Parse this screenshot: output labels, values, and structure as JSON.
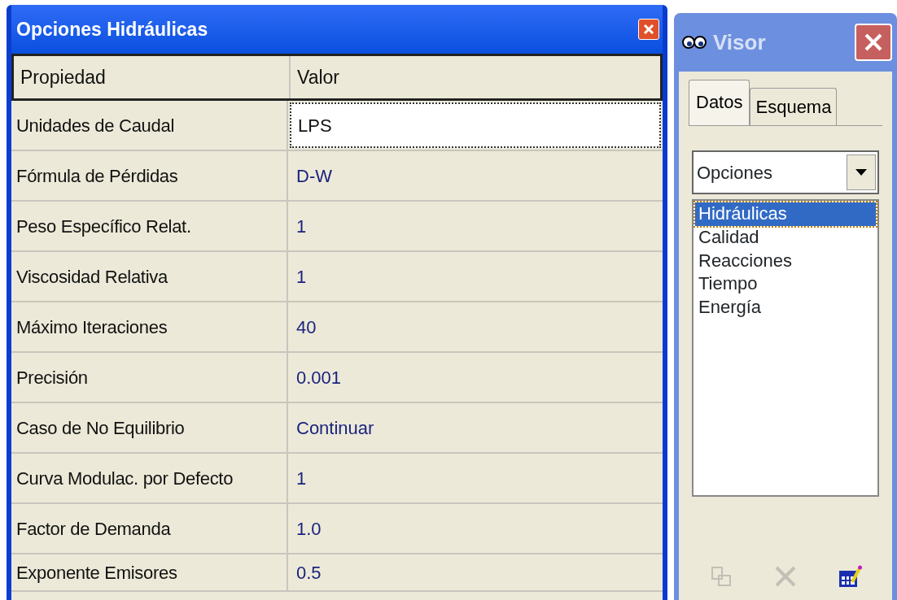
{
  "left_window": {
    "title": "Opciones Hidráulicas",
    "table": {
      "columns": [
        "Propiedad",
        "Valor"
      ],
      "rows": [
        {
          "property": "Unidades de Caudal",
          "value": "LPS",
          "selected": true
        },
        {
          "property": "Fórmula de Pérdidas",
          "value": "D-W",
          "selected": false
        },
        {
          "property": "Peso Específico Relat.",
          "value": "1",
          "selected": false
        },
        {
          "property": "Viscosidad Relativa",
          "value": "1",
          "selected": false
        },
        {
          "property": "Máximo Iteraciones",
          "value": "40",
          "selected": false
        },
        {
          "property": "Precisión",
          "value": "0.001",
          "selected": false
        },
        {
          "property": "Caso de No Equilibrio",
          "value": "Continuar",
          "selected": false
        },
        {
          "property": "Curva Modulac. por Defecto",
          "value": "1",
          "selected": false
        },
        {
          "property": "Factor de Demanda",
          "value": "1.0",
          "selected": false
        },
        {
          "property": "Exponente Emisores",
          "value": "0.5",
          "selected": false
        }
      ]
    }
  },
  "right_window": {
    "title": "Visor",
    "tabs": [
      {
        "label": "Datos",
        "selected": true
      },
      {
        "label": "Esquema",
        "selected": false
      }
    ],
    "dropdown": {
      "value": "Opciones"
    },
    "list": [
      {
        "label": "Hidráulicas",
        "selected": true
      },
      {
        "label": "Calidad",
        "selected": false
      },
      {
        "label": "Reacciones",
        "selected": false
      },
      {
        "label": "Tiempo",
        "selected": false
      },
      {
        "label": "Energía",
        "selected": false
      }
    ],
    "toolbar": [
      {
        "kind": "copy",
        "disabled": true
      },
      {
        "kind": "delete",
        "disabled": true
      },
      {
        "kind": "edit",
        "disabled": false
      }
    ]
  }
}
